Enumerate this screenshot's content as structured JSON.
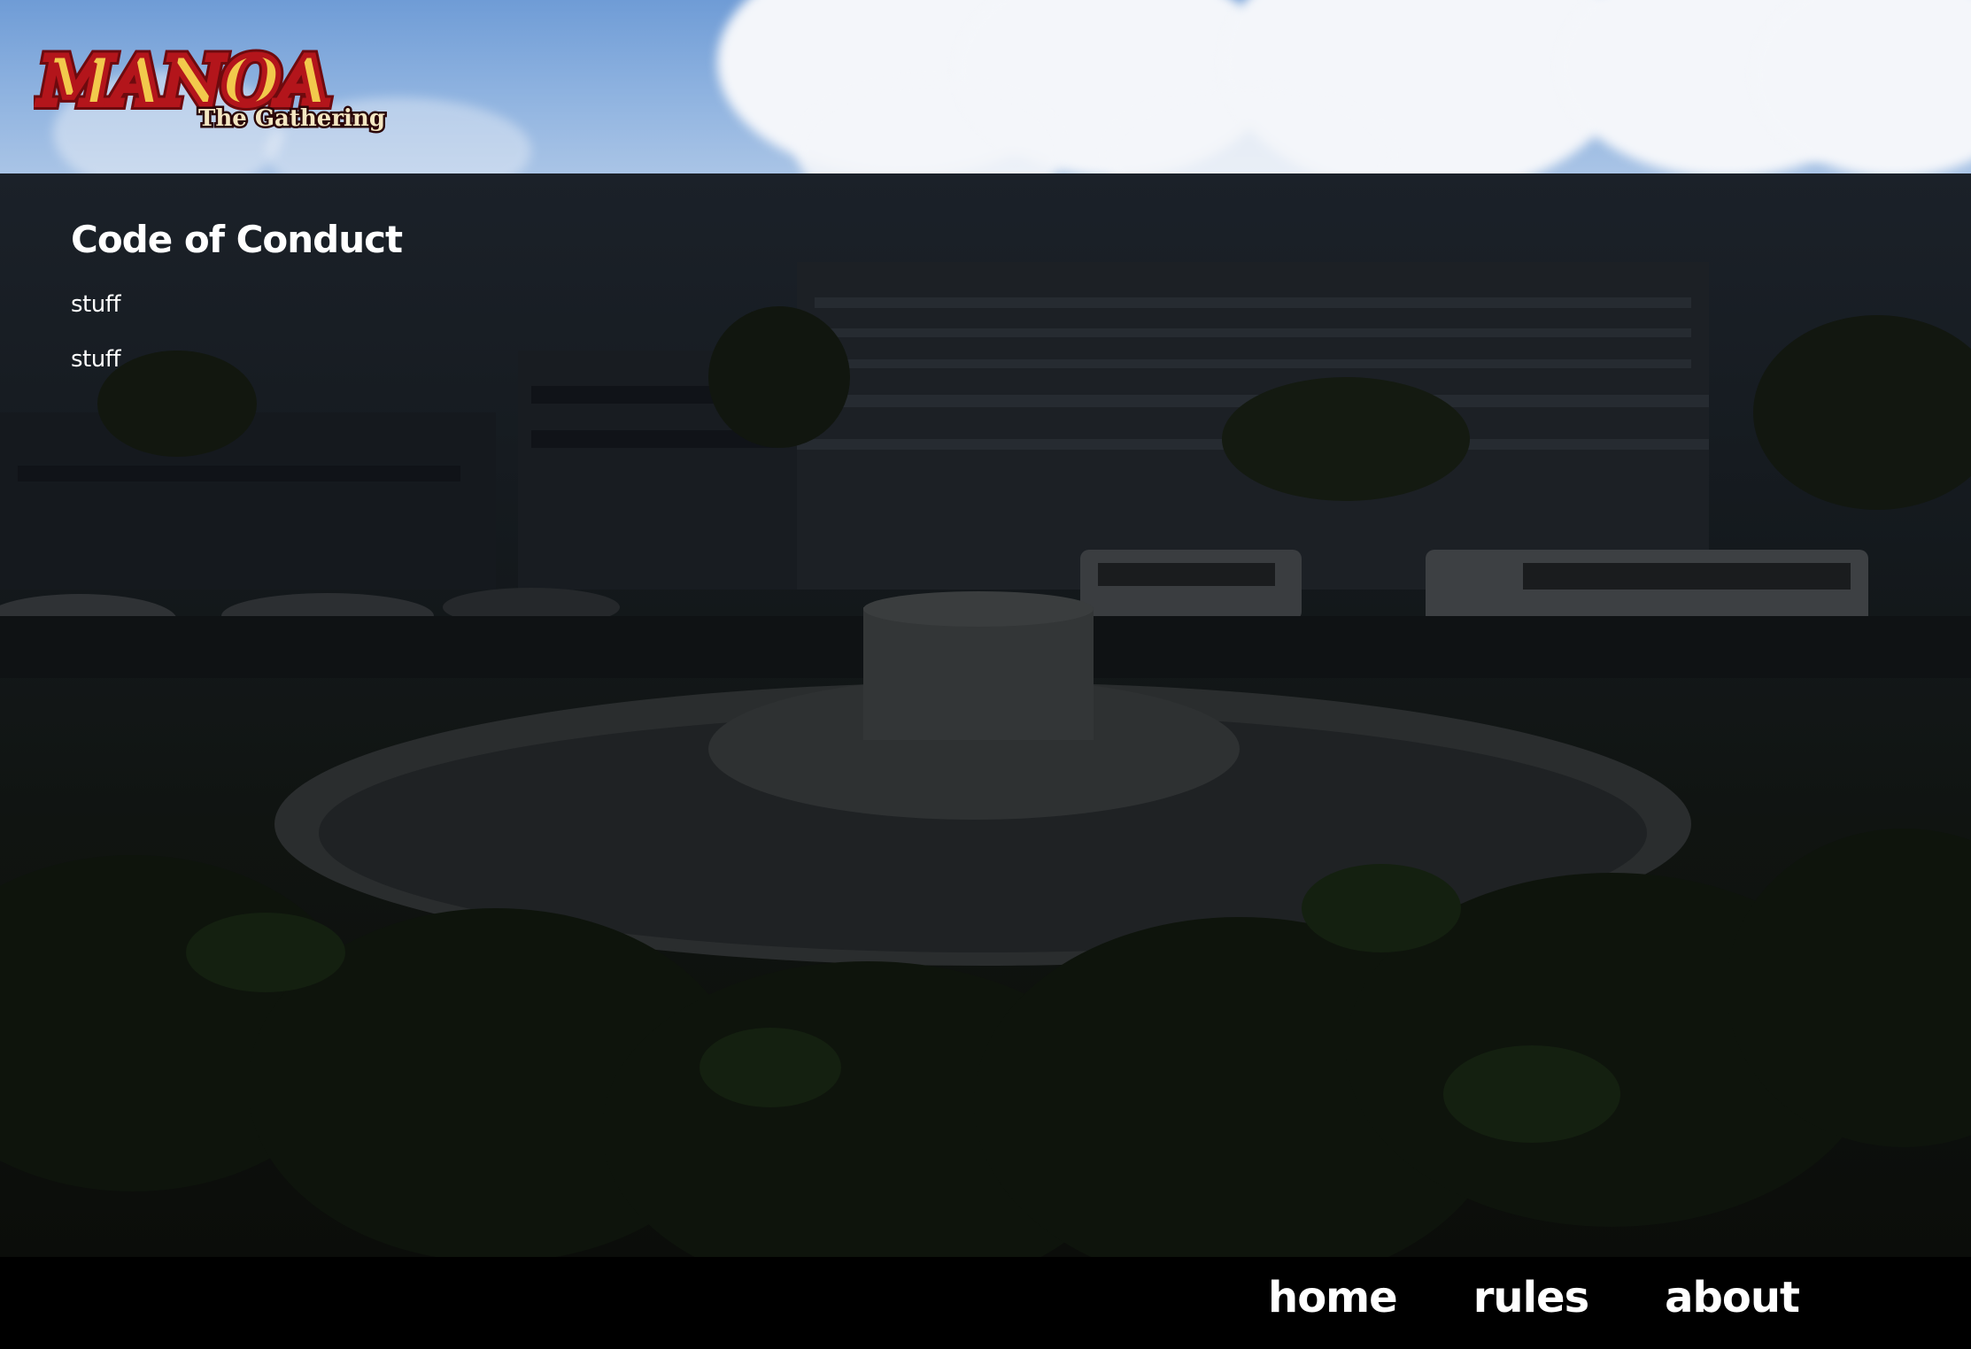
{
  "header": {
    "logo": {
      "title": "MANOA",
      "subtitle": "The Gathering"
    }
  },
  "main": {
    "heading": "Code of Conduct",
    "paragraphs": [
      "stuff",
      "stuff"
    ]
  },
  "footer": {
    "nav": [
      {
        "label": "home"
      },
      {
        "label": "rules"
      },
      {
        "label": "about"
      }
    ]
  },
  "colors": {
    "logo_gold": "#f2c94c",
    "logo_red": "#b3151b",
    "footer_bg": "#000000",
    "text": "#ffffff"
  }
}
